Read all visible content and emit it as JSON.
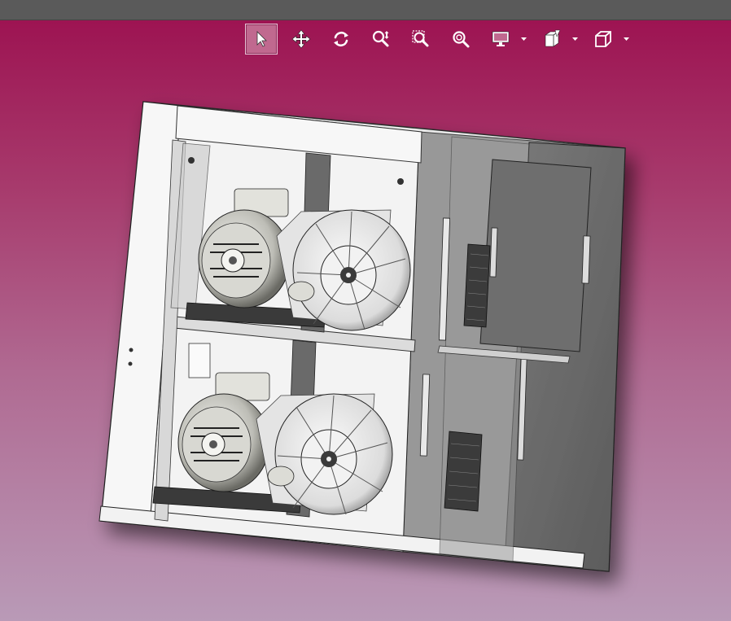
{
  "window": {
    "title": ""
  },
  "toolbar": {
    "tools": [
      {
        "name": "select-tool",
        "icon": "cursor-arrow-icon",
        "active": true
      },
      {
        "name": "pan-tool",
        "icon": "move-arrows-icon",
        "active": false
      },
      {
        "name": "rotate-tool",
        "icon": "rotate-icon",
        "active": false
      },
      {
        "name": "zoom-tool",
        "icon": "zoom-icon",
        "active": false
      },
      {
        "name": "zoom-window-tool",
        "icon": "zoom-window-icon",
        "active": false
      },
      {
        "name": "zoom-fit-tool",
        "icon": "zoom-fit-icon",
        "active": false
      },
      {
        "name": "display-mode-tool",
        "icon": "monitor-icon",
        "active": false,
        "dropdown": true
      },
      {
        "name": "section-view-tool",
        "icon": "section-box-icon",
        "active": false,
        "dropdown": true
      },
      {
        "name": "view-orientation-tool",
        "icon": "cube-icon",
        "active": false,
        "dropdown": true
      }
    ]
  },
  "colors": {
    "topbar": "#5a5a5a",
    "background_top": "#9c0f4f",
    "background_bottom": "#b99ab7",
    "active_tool": "#c0698f",
    "icon_color": "#ffffff"
  },
  "viewport": {
    "model": "cabinet-with-two-motor-fan-units"
  }
}
